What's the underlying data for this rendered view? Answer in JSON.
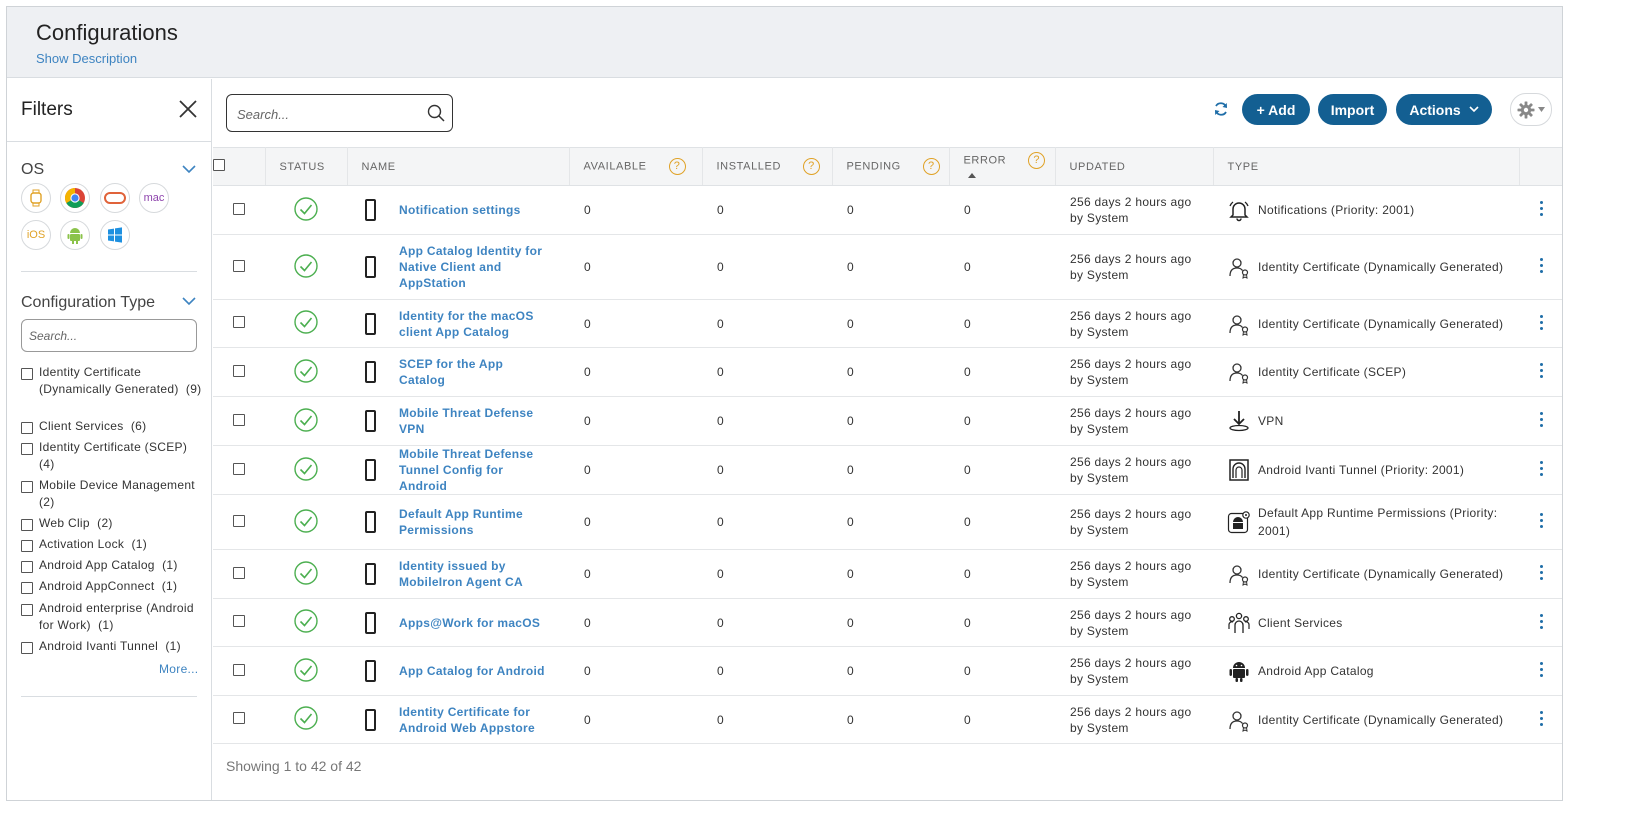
{
  "header": {
    "title": "Configurations",
    "show_description": "Show Description"
  },
  "filters": {
    "title": "Filters",
    "os": {
      "title": "OS",
      "icons": [
        {
          "name": "watch-os-icon"
        },
        {
          "name": "chrome-icon"
        },
        {
          "name": "vision-os-icon"
        },
        {
          "name": "mac-icon",
          "label": "mac"
        },
        {
          "name": "ios-icon",
          "label": "iOS"
        },
        {
          "name": "android-icon"
        },
        {
          "name": "windows-icon"
        }
      ]
    },
    "config_type": {
      "title": "Configuration Type",
      "search_placeholder": "Search...",
      "items": [
        {
          "label": "Identity Certificate (Dynamically Generated)",
          "count": "(9)"
        },
        {
          "label": "Client Services",
          "count": "(6)"
        },
        {
          "label": "Identity Certificate (SCEP)",
          "count": "(4)"
        },
        {
          "label": "Mobile Device Management",
          "count": "(2)"
        },
        {
          "label": "Web Clip",
          "count": "(2)"
        },
        {
          "label": "Activation Lock",
          "count": "(1)"
        },
        {
          "label": "Android App Catalog",
          "count": "(1)"
        },
        {
          "label": "Android AppConnect",
          "count": "(1)"
        },
        {
          "label": "Android enterprise (Android for Work)",
          "count": "(1)"
        },
        {
          "label": "Android Ivanti Tunnel",
          "count": "(1)"
        }
      ],
      "more": "More..."
    }
  },
  "toolbar": {
    "search_placeholder": "Search...",
    "add_label": "+ Add",
    "import_label": "Import",
    "actions_label": "Actions"
  },
  "table": {
    "columns": {
      "status": "STATUS",
      "name": "NAME",
      "available": "AVAILABLE",
      "installed": "INSTALLED",
      "pending": "PENDING",
      "error": "ERROR",
      "updated": "UPDATED",
      "type": "TYPE"
    },
    "help_mark": "?",
    "rows": [
      {
        "name": "Notification settings",
        "available": "0",
        "installed": "0",
        "pending": "0",
        "error": "0",
        "updated": "256 days 2 hours ago",
        "by": "by System",
        "type": "Notifications (Priority: 2001)",
        "type_icon": "bell-icon"
      },
      {
        "name": "App Catalog Identity for Native Client and AppStation",
        "available": "0",
        "installed": "0",
        "pending": "0",
        "error": "0",
        "updated": "256 days 2 hours ago",
        "by": "by System",
        "type": "Identity Certificate (Dynamically Generated)",
        "type_icon": "certificate-icon"
      },
      {
        "name": "Identity for the macOS client App Catalog",
        "available": "0",
        "installed": "0",
        "pending": "0",
        "error": "0",
        "updated": "256 days 2 hours ago",
        "by": "by System",
        "type": "Identity Certificate (Dynamically Generated)",
        "type_icon": "certificate-icon"
      },
      {
        "name": "SCEP for the App Catalog",
        "available": "0",
        "installed": "0",
        "pending": "0",
        "error": "0",
        "updated": "256 days 2 hours ago",
        "by": "by System",
        "type": "Identity Certificate (SCEP)",
        "type_icon": "certificate-icon"
      },
      {
        "name": "Mobile Threat Defense VPN",
        "available": "0",
        "installed": "0",
        "pending": "0",
        "error": "0",
        "updated": "256 days 2 hours ago",
        "by": "by System",
        "type": "VPN",
        "type_icon": "vpn-icon"
      },
      {
        "name": "Mobile Threat Defense Tunnel Config for Android",
        "available": "0",
        "installed": "0",
        "pending": "0",
        "error": "0",
        "updated": "256 days 2 hours ago",
        "by": "by System",
        "type": "Android Ivanti Tunnel (Priority: 2001)",
        "type_icon": "tunnel-icon"
      },
      {
        "name": "Default App Runtime Permissions",
        "available": "0",
        "installed": "0",
        "pending": "0",
        "error": "0",
        "updated": "256 days 2 hours ago",
        "by": "by System",
        "type": "Default App Runtime Permissions (Priority: 2001)",
        "type_icon": "android-gear-icon"
      },
      {
        "name": "Identity issued by MobileIron Agent CA",
        "available": "0",
        "installed": "0",
        "pending": "0",
        "error": "0",
        "updated": "256 days 2 hours ago",
        "by": "by System",
        "type": "Identity Certificate (Dynamically Generated)",
        "type_icon": "certificate-icon"
      },
      {
        "name": "Apps@Work for macOS",
        "available": "0",
        "installed": "0",
        "pending": "0",
        "error": "0",
        "updated": "256 days 2 hours ago",
        "by": "by System",
        "type": "Client Services",
        "type_icon": "client-services-icon"
      },
      {
        "name": "App Catalog for Android",
        "available": "0",
        "installed": "0",
        "pending": "0",
        "error": "0",
        "updated": "256 days 2 hours ago",
        "by": "by System",
        "type": "Android App Catalog",
        "type_icon": "android-icon"
      },
      {
        "name": "Identity Certificate for Android Web Appstore",
        "available": "0",
        "installed": "0",
        "pending": "0",
        "error": "0",
        "updated": "256 days 2 hours ago",
        "by": "by System",
        "type": "Identity Certificate (Dynamically Generated)",
        "type_icon": "certificate-icon"
      }
    ]
  },
  "footer": {
    "showing": "Showing 1 to 42 of 42"
  },
  "colors": {
    "primary_button": "#135f92",
    "link": "#3e84c1",
    "status_ok": "#4caf50",
    "help_mark": "#e0a227"
  }
}
